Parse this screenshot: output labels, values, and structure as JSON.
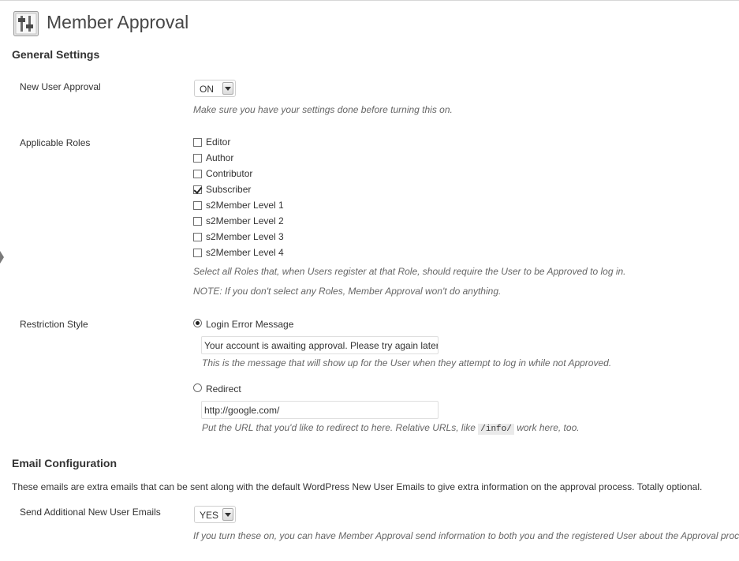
{
  "header": {
    "title": "Member Approval"
  },
  "general": {
    "heading": "General Settings",
    "approval": {
      "label": "New User Approval",
      "value": "ON",
      "note": "Make sure you have your settings done before turning this on."
    },
    "roles": {
      "label": "Applicable Roles",
      "items": [
        {
          "label": "Editor",
          "checked": false
        },
        {
          "label": "Author",
          "checked": false
        },
        {
          "label": "Contributor",
          "checked": false
        },
        {
          "label": "Subscriber",
          "checked": true
        },
        {
          "label": "s2Member Level 1",
          "checked": false
        },
        {
          "label": "s2Member Level 2",
          "checked": false
        },
        {
          "label": "s2Member Level 3",
          "checked": false
        },
        {
          "label": "s2Member Level 4",
          "checked": false
        }
      ],
      "note1": "Select all Roles that, when Users register at that Role, should require the User to be Approved to log in.",
      "note2": "NOTE: If you don't select any Roles, Member Approval won't do anything."
    },
    "restriction": {
      "label": "Restriction Style",
      "login_option": "Login Error Message",
      "login_message_value": "Your account is awaiting approval. Please try again later.",
      "login_note": "This is the message that will show up for the User when they attempt to log in while not Approved.",
      "redirect_option": "Redirect",
      "redirect_value": "http://google.com/",
      "redirect_note_before": "Put the URL that you'd like to redirect to here. Relative URLs, like",
      "redirect_note_code": "/info/",
      "redirect_note_after": "work here, too.",
      "selected": "login"
    }
  },
  "email": {
    "heading": "Email Configuration",
    "intro": "These emails are extra emails that can be sent along with the default WordPress New User Emails to give extra information on the approval process. Totally optional.",
    "send": {
      "label": "Send Additional New User Emails",
      "value": "YES",
      "note": "If you turn these on, you can have Member Approval send information to both you and the registered User about the Approval process."
    }
  }
}
